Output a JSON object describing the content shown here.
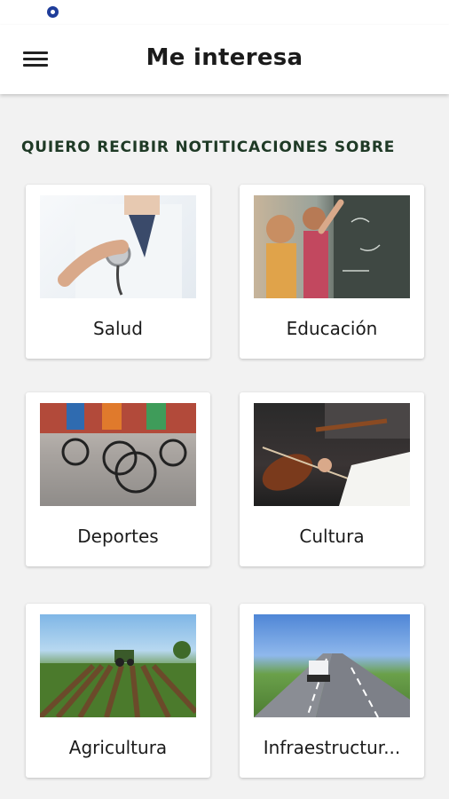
{
  "header": {
    "title": "Me interesa"
  },
  "section": {
    "heading": "QUIERO RECIBIR NOTITICACIONES SOBRE"
  },
  "categories": [
    {
      "label": "Salud",
      "icon": "stethoscope-photo"
    },
    {
      "label": "Educación",
      "icon": "classroom-photo"
    },
    {
      "label": "Deportes",
      "icon": "cycling-photo"
    },
    {
      "label": "Cultura",
      "icon": "violin-photo"
    },
    {
      "label": "Agricultura",
      "icon": "tractor-field-photo"
    },
    {
      "label": "Infraestructur...",
      "icon": "highway-truck-photo"
    }
  ],
  "colors": {
    "heading": "#1f3a26",
    "background": "#f2f2f2",
    "card": "#ffffff"
  }
}
